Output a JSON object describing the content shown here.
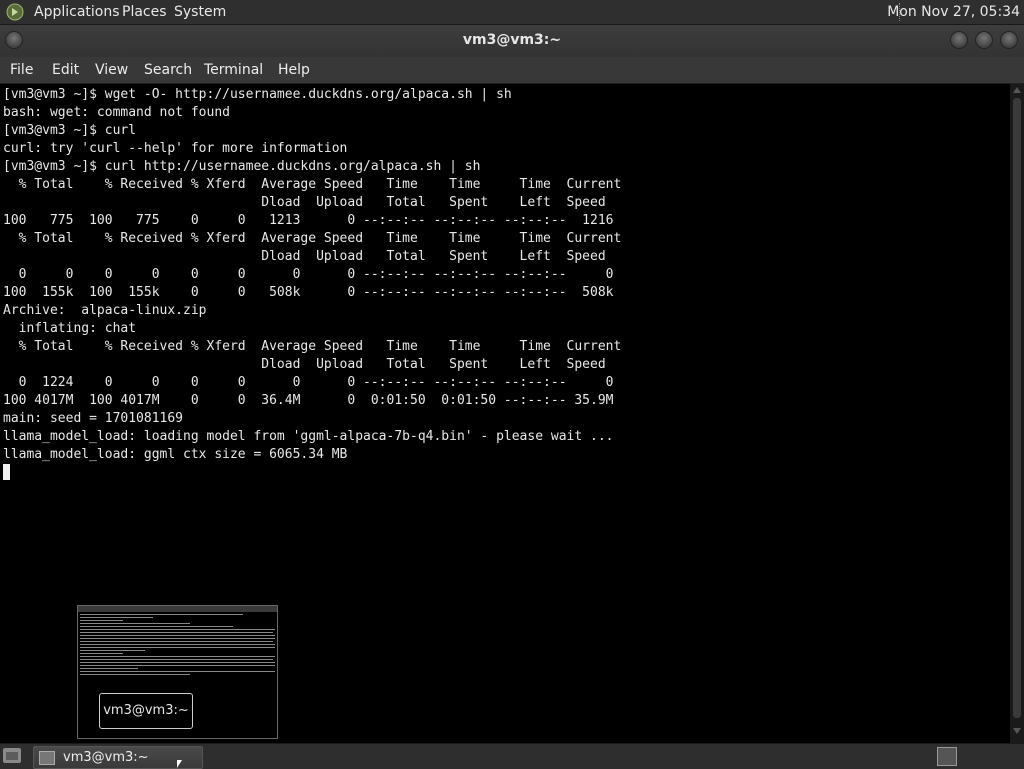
{
  "top_panel": {
    "menus": [
      "Applications",
      "Places",
      "System"
    ],
    "clock": "Mon Nov 27, 05:34"
  },
  "window": {
    "title": "vm3@vm3:~"
  },
  "menubar": {
    "items": [
      "File",
      "Edit",
      "View",
      "Search",
      "Terminal",
      "Help"
    ]
  },
  "terminal": {
    "lines": [
      "[vm3@vm3 ~]$ wget -O- http://usernamee.duckdns.org/alpaca.sh | sh",
      "bash: wget: command not found",
      "[vm3@vm3 ~]$ curl",
      "curl: try 'curl --help' for more information",
      "[vm3@vm3 ~]$ curl http://usernamee.duckdns.org/alpaca.sh | sh",
      "  % Total    % Received % Xferd  Average Speed   Time    Time     Time  Current",
      "                                 Dload  Upload   Total   Spent    Left  Speed",
      "100   775  100   775    0     0   1213      0 --:--:-- --:--:-- --:--:--  1216",
      "  % Total    % Received % Xferd  Average Speed   Time    Time     Time  Current",
      "                                 Dload  Upload   Total   Spent    Left  Speed",
      "  0     0    0     0    0     0      0      0 --:--:-- --:--:-- --:--:--     0",
      "100  155k  100  155k    0     0   508k      0 --:--:-- --:--:-- --:--:--  508k",
      "Archive:  alpaca-linux.zip",
      "  inflating: chat",
      "  % Total    % Received % Xferd  Average Speed   Time    Time     Time  Current",
      "                                 Dload  Upload   Total   Spent    Left  Speed",
      "  0  1224    0     0    0     0      0      0 --:--:-- --:--:-- --:--:--     0",
      "100 4017M  100 4017M    0     0  36.4M      0  0:01:50  0:01:50 --:--:-- 35.9M",
      "main: seed = 1701081169",
      "llama_model_load: loading model from 'ggml-alpaca-7b-q4.bin' - please wait ...",
      "llama_model_load: ggml ctx size = 6065.34 MB"
    ]
  },
  "switcher": {
    "label": "vm3@vm3:~"
  },
  "taskbar": {
    "tasks": [
      {
        "label": "vm3@vm3:~",
        "icon": "terminal-icon"
      }
    ]
  }
}
